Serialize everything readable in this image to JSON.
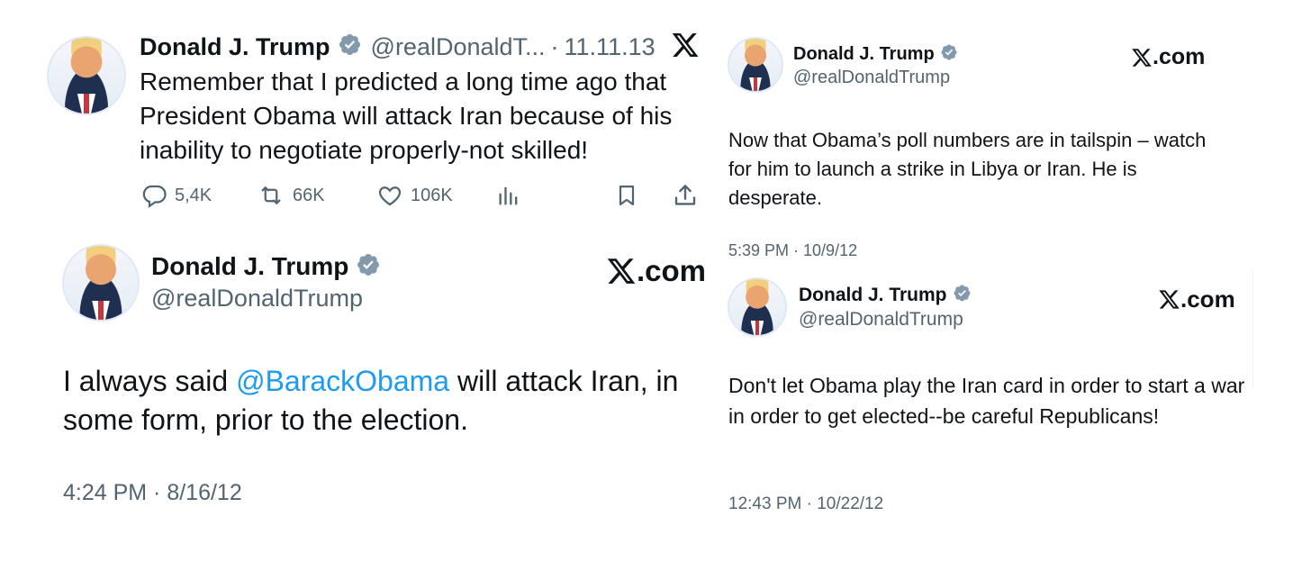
{
  "tweet1": {
    "name": "Donald J. Trump",
    "handle": "@realDonaldT...",
    "separator": "·",
    "date": "11.11.13",
    "text": "Remember that I predicted a long time ago that President Obama will attack Iran because of his inability to negotiate properly-not skilled!",
    "actions": {
      "replies": "5,4K",
      "retweets": "66K",
      "likes": "106K"
    }
  },
  "tweet2": {
    "name": "Donald J. Trump",
    "handle": "@realDonaldTrump",
    "brand": ".com",
    "text_before": "I always said ",
    "mention": "@BarackObama",
    "text_after": " will attack Iran, in some form, prior to the election.",
    "timestamp": "4:24 PM · 8/16/12"
  },
  "tweet3": {
    "name": "Donald J. Trump",
    "handle": "@realDonaldTrump",
    "brand": ".com",
    "text": "Now that Obama’s poll numbers are in tailspin – watch for him to launch a strike in Libya or Iran.  He is desperate.",
    "timestamp": "5:39 PM · 10/9/12"
  },
  "tweet4": {
    "name": "Donald J. Trump",
    "handle": "@realDonaldTrump",
    "brand": ".com",
    "text": "Don't let Obama play the Iran card in order to start a war in order to get elected--be careful Republicans!",
    "timestamp": "12:43 PM · 10/22/12"
  },
  "colors": {
    "verified": "#829aab",
    "mention": "#1d9bf0",
    "secondary_text": "#536471"
  }
}
